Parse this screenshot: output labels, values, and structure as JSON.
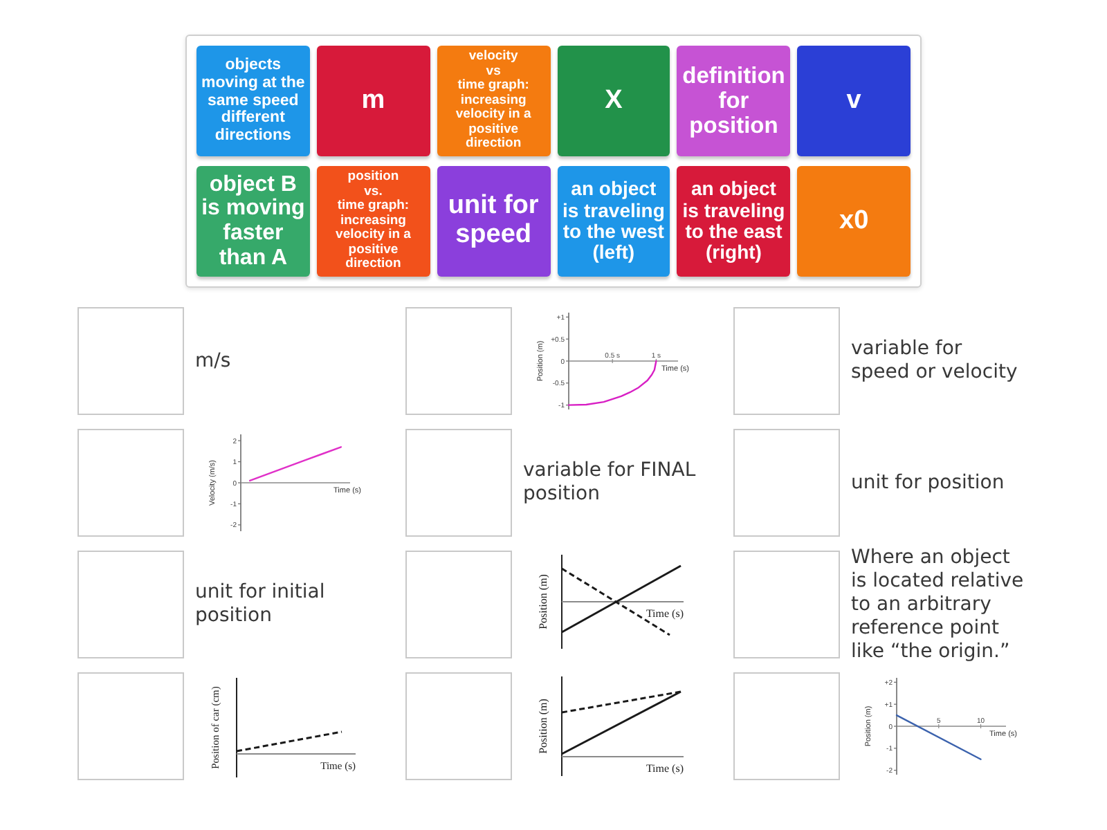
{
  "tiles": [
    {
      "text": "objects moving at the same speed different directions",
      "color": "#1e96e8"
    },
    {
      "text": "m",
      "color": "#d71a3a"
    },
    {
      "text": "velocity\nvs\ntime graph:\nincreasing velocity in a positive direction",
      "color": "#f47b10"
    },
    {
      "text": "X",
      "color": "#22924a"
    },
    {
      "text": "definition for position",
      "color": "#c653d4"
    },
    {
      "text": "v",
      "color": "#2b3fd6"
    },
    {
      "text": "object B is moving faster than A",
      "color": "#36a96a"
    },
    {
      "text": "position\nvs.\ntime graph:\nincreasing velocity in a positive direction",
      "color": "#f2511b"
    },
    {
      "text": "unit for speed",
      "color": "#8b3fdc"
    },
    {
      "text": "an object is traveling to the west (left)",
      "color": "#1e96e8"
    },
    {
      "text": "an object is traveling to the east (right)",
      "color": "#d71a3a"
    },
    {
      "text": "x0",
      "color": "#f47b10"
    }
  ],
  "slots": [
    {
      "kind": "text",
      "text": "m/s"
    },
    {
      "kind": "chart",
      "chart_data": {
        "type": "line",
        "xlabel": "Time (s)",
        "ylabel": "Position (m)",
        "x": [
          0,
          0.2,
          0.4,
          0.6,
          0.7,
          0.8,
          0.9,
          0.95,
          0.98,
          1
        ],
        "series": [
          {
            "color": "#d81fc4",
            "values": [
              -1,
              -0.99,
              -0.93,
              -0.8,
              -0.71,
              -0.6,
              -0.44,
              -0.31,
              -0.2,
              0
            ]
          }
        ],
        "xlim": [
          0,
          1.25
        ],
        "ylim": [
          -1.1,
          1.1
        ],
        "xticks": [
          {
            "value": 0.5,
            "label": "0.5 s"
          },
          {
            "value": 1,
            "label": "1 s"
          }
        ],
        "yticks": [
          {
            "value": 1,
            "label": "+1"
          },
          {
            "value": 0.5,
            "label": "+0.5"
          },
          0,
          -0.5,
          -1
        ]
      }
    },
    {
      "kind": "text",
      "text": "variable for speed or velocity"
    },
    {
      "kind": "chart",
      "chart_data": {
        "type": "line",
        "xlabel": "Time (s)",
        "ylabel": "Velocity (m/s)",
        "categories": [
          null,
          null,
          null,
          null,
          null,
          null
        ],
        "series": [
          {
            "color": "#e030c8",
            "values": [
              0.1,
              0.42,
              0.74,
              1.06,
              1.38,
              1.7
            ]
          }
        ],
        "ylim": [
          -2.3,
          2.3
        ],
        "yticks": [
          2,
          1,
          0,
          -1,
          -2
        ]
      }
    },
    {
      "kind": "text",
      "text": "variable for FINAL position"
    },
    {
      "kind": "text",
      "text": "unit for position"
    },
    {
      "kind": "text",
      "text": "unit for initial position"
    },
    {
      "kind": "crossing",
      "xlabel": "Time (s)",
      "ylabel": "Position (m)"
    },
    {
      "kind": "text",
      "text": "Where an object is located relative to an arbitrary reference point like “the origin.”"
    },
    {
      "kind": "dashed",
      "xlabel": "Time (s)",
      "ylabel": "Position of car (cm)"
    },
    {
      "kind": "converging",
      "xlabel": "Time (s)",
      "ylabel": "Position (m)"
    },
    {
      "kind": "chart",
      "chart_data": {
        "type": "line",
        "xlabel": "Time (s)",
        "ylabel": "Position (m)",
        "x": [
          0,
          10
        ],
        "series": [
          {
            "color": "#3b62ad",
            "values": [
              0.5,
              -1.5
            ]
          }
        ],
        "xlim": [
          0,
          13
        ],
        "ylim": [
          -2.2,
          2.2
        ],
        "xticks": [
          5,
          10
        ],
        "yticks": [
          {
            "value": 2,
            "label": "+2"
          },
          {
            "value": 1,
            "label": "+1"
          },
          0,
          -1,
          -2
        ]
      }
    }
  ]
}
